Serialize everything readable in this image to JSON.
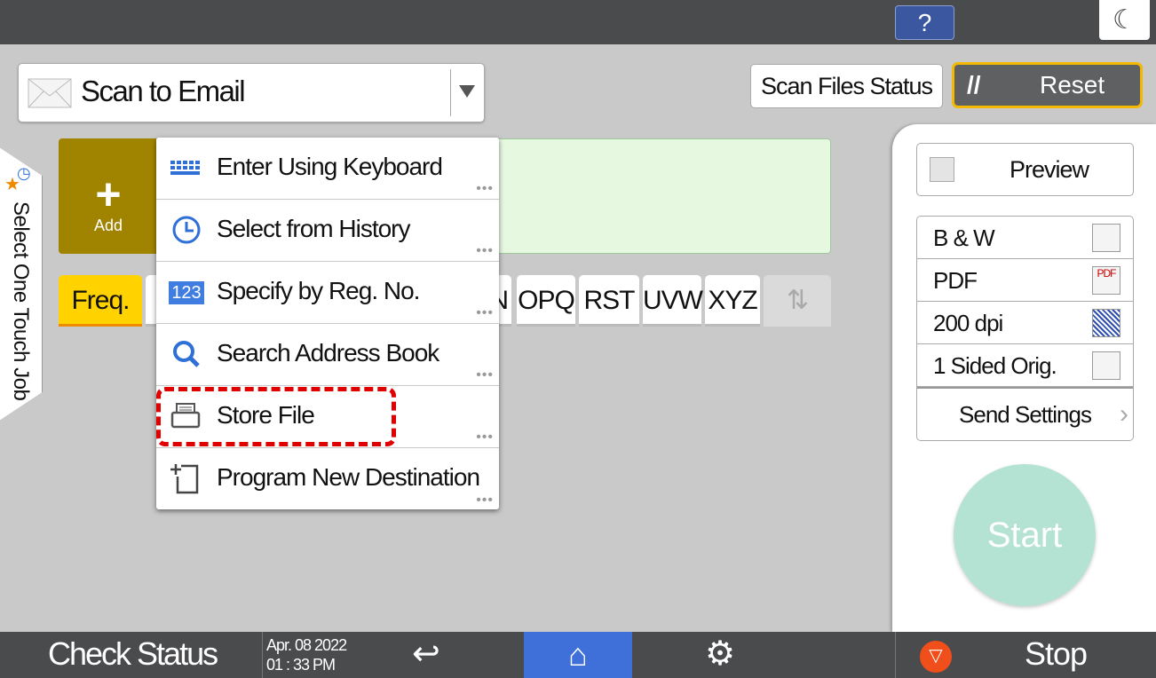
{
  "topbar": {
    "help_label": "?",
    "moon_icon": "moon-icon"
  },
  "mode": {
    "label": "Scan to Email",
    "icon": "envelope-icon"
  },
  "header": {
    "scan_files_status": "Scan Files Status",
    "reset": "Reset"
  },
  "destination": {
    "add_label": "Add"
  },
  "tabs": [
    {
      "label": "Freq."
    },
    {
      "label": "N"
    },
    {
      "label": "OPQ"
    },
    {
      "label": "RST"
    },
    {
      "label": "UVW"
    },
    {
      "label": "XYZ"
    }
  ],
  "side_tab": {
    "label": "Select One Touch Job"
  },
  "menu": {
    "items": [
      {
        "label": "Enter Using Keyboard",
        "icon": "keyboard-icon"
      },
      {
        "label": "Select from History",
        "icon": "clock-icon"
      },
      {
        "label": "Specify by Reg. No.",
        "icon": "123-icon"
      },
      {
        "label": "Search Address Book",
        "icon": "search-icon"
      },
      {
        "label": "Store File",
        "icon": "store-file-icon"
      },
      {
        "label": "Program New Destination",
        "icon": "program-destination-icon"
      }
    ],
    "more": "•••",
    "badge_123": "123"
  },
  "settings": {
    "preview": "Preview",
    "rows": [
      {
        "label": "B & W"
      },
      {
        "label": "PDF"
      },
      {
        "label": "200 dpi"
      },
      {
        "label": "1 Sided Orig."
      }
    ],
    "send_settings": "Send Settings",
    "pdf_badge": "PDF"
  },
  "start": "Start",
  "bottom": {
    "check_status": "Check Status",
    "date": "Apr. 08 2022",
    "time": "01 : 33 PM",
    "stop": "Stop"
  },
  "colors": {
    "highlight": "#e00000",
    "accent": "#f5b800",
    "home": "#3f6fd8",
    "add": "#a08400"
  }
}
